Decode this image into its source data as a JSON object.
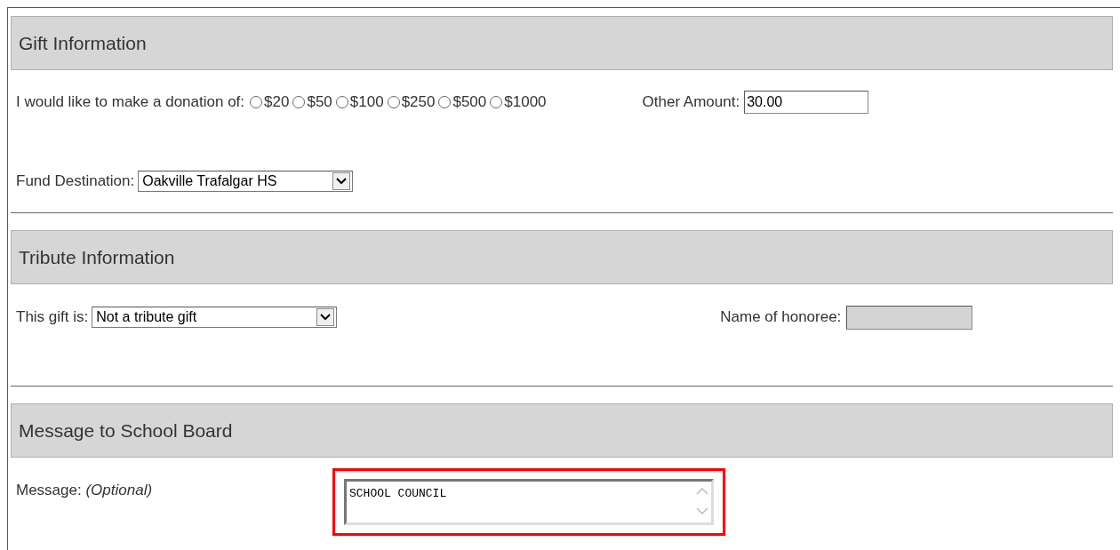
{
  "gift_section": {
    "title": "Gift Information",
    "donation_label": "I would like to make a donation of:",
    "amounts": [
      {
        "label": "$20",
        "selected": false
      },
      {
        "label": "$50",
        "selected": false
      },
      {
        "label": "$100",
        "selected": false
      },
      {
        "label": "$250",
        "selected": false
      },
      {
        "label": "$500",
        "selected": false
      },
      {
        "label": "$1000",
        "selected": false
      }
    ],
    "other_amount": {
      "label": "Other Amount:",
      "value": "30.00"
    },
    "fund_destination": {
      "label": "Fund Destination:",
      "value": "Oakville Trafalgar HS"
    }
  },
  "tribute_section": {
    "title": "Tribute Information",
    "gift_type": {
      "label": "This gift is:",
      "value": "Not a tribute gift"
    },
    "honoree": {
      "label": "Name of honoree:",
      "disabled": true
    }
  },
  "message_section": {
    "title": "Message to School Board",
    "message": {
      "label": "Message:",
      "hint": "(Optional)",
      "value": "SCHOOL COUNCIL",
      "highlighted": true
    }
  }
}
